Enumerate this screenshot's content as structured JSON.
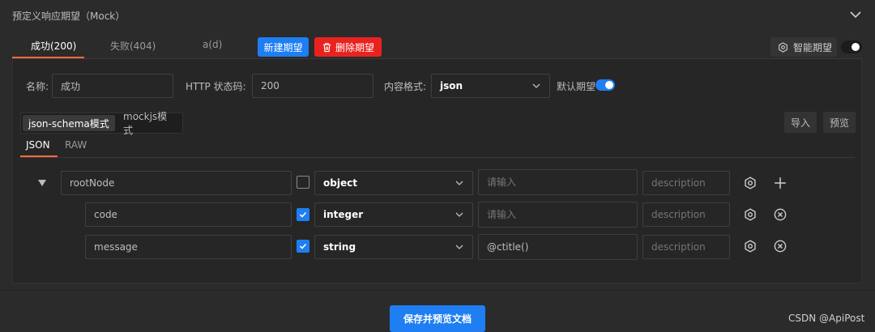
{
  "header": {
    "title": "预定义响应期望（Mock）",
    "collapse_icon": "chevron-down-icon"
  },
  "tabs": [
    {
      "label": "成功(200)",
      "active": true
    },
    {
      "label": "失败(404)",
      "active": false
    },
    {
      "label": "a(d)",
      "active": false
    }
  ],
  "actions": {
    "new_label": "新建期望",
    "delete_label": "删除期望",
    "delete_icon": "trash-icon"
  },
  "smart": {
    "label": "智能期望",
    "icon": "gear-icon",
    "enabled": false
  },
  "form": {
    "name_label": "名称:",
    "name_value": "成功",
    "status_label": "HTTP 状态码:",
    "status_value": "200",
    "format_label": "内容格式:",
    "format_value": "json",
    "default_label": "默认期望",
    "default_enabled": true
  },
  "modes": {
    "schema_label": "json-schema模式",
    "mockjs_label": "mockjs模式",
    "active": "json-schema"
  },
  "tools": {
    "import_label": "导入",
    "preview_label": "预览"
  },
  "subtabs": [
    {
      "label": "JSON",
      "active": true
    },
    {
      "label": "RAW",
      "active": false
    }
  ],
  "rows": [
    {
      "name": "rootNode",
      "required": false,
      "type": "object",
      "mock_value": "",
      "mock_placeholder": "请输入",
      "description_placeholder": "description",
      "action_icon": "plus-icon"
    },
    {
      "name": "code",
      "required": true,
      "type": "integer",
      "mock_value": "",
      "mock_placeholder": "请输入",
      "description_placeholder": "description",
      "action_icon": "remove-icon"
    },
    {
      "name": "message",
      "required": true,
      "type": "string",
      "mock_value": "@ctitle()",
      "mock_placeholder": "请输入",
      "description_placeholder": "description",
      "action_icon": "remove-icon"
    }
  ],
  "footer": {
    "save_label": "保存并预览文档",
    "watermark": "CSDN @ApiPost"
  },
  "colors": {
    "accent": "#1e7ef2",
    "danger": "#e8231f",
    "tab_underline": "#ff6a3a",
    "background": "#2b2b2b"
  }
}
